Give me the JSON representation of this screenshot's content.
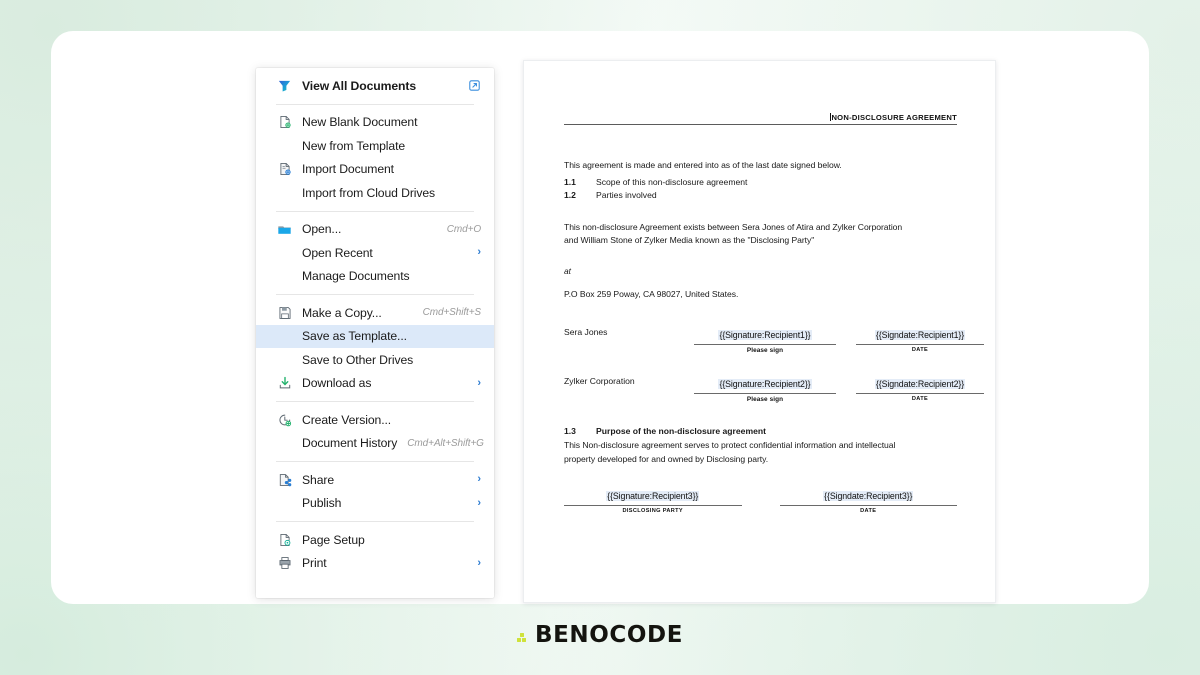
{
  "app": {
    "background_accent": "#e7f4ec",
    "canvas_color": "#ffffff"
  },
  "menu": {
    "highlight_color": "#dce9f9",
    "groups": [
      {
        "items": [
          {
            "label": "View All Documents",
            "icon": "writer-logo-icon",
            "bold": true,
            "trailing_icon": "external-link-icon",
            "shortcut": "",
            "submenu": false
          }
        ]
      },
      {
        "items": [
          {
            "label": "New Blank Document",
            "icon": "new-document-icon",
            "shortcut": "",
            "submenu": false
          },
          {
            "label": "New from Template",
            "icon": "",
            "shortcut": "",
            "submenu": false
          },
          {
            "label": "Import Document",
            "icon": "import-document-icon",
            "shortcut": "",
            "submenu": false
          },
          {
            "label": "Import from Cloud Drives",
            "icon": "",
            "shortcut": "",
            "submenu": false
          }
        ]
      },
      {
        "items": [
          {
            "label": "Open...",
            "icon": "folder-open-icon",
            "shortcut": "Cmd+O",
            "submenu": false
          },
          {
            "label": "Open Recent",
            "icon": "",
            "shortcut": "",
            "submenu": true
          },
          {
            "label": "Manage Documents",
            "icon": "",
            "shortcut": "",
            "submenu": false
          }
        ]
      },
      {
        "items": [
          {
            "label": "Make a Copy...",
            "icon": "save-floppy-icon",
            "shortcut": "Cmd+Shift+S",
            "submenu": false
          },
          {
            "label": "Save as Template...",
            "icon": "",
            "shortcut": "",
            "submenu": false,
            "selected": true
          },
          {
            "label": "Save to Other Drives",
            "icon": "",
            "shortcut": "",
            "submenu": false
          },
          {
            "label": "Download as",
            "icon": "download-icon",
            "shortcut": "",
            "submenu": true
          }
        ]
      },
      {
        "items": [
          {
            "label": "Create Version...",
            "icon": "clock-add-icon",
            "shortcut": "",
            "submenu": false
          },
          {
            "label": "Document History",
            "icon": "",
            "shortcut": "Cmd+Alt+Shift+G",
            "submenu": false
          }
        ]
      },
      {
        "items": [
          {
            "label": "Share",
            "icon": "share-document-icon",
            "shortcut": "",
            "submenu": true
          },
          {
            "label": "Publish",
            "icon": "",
            "shortcut": "",
            "submenu": true
          }
        ]
      },
      {
        "items": [
          {
            "label": "Page Setup",
            "icon": "page-setup-icon",
            "shortcut": "",
            "submenu": false
          },
          {
            "label": "Print",
            "icon": "printer-icon",
            "shortcut": "",
            "submenu": true
          }
        ]
      }
    ]
  },
  "document": {
    "header": "NON-DISCLOSURE AGREEMENT",
    "intro": "This agreement is made and entered into as of the last date signed below.",
    "clauses": [
      {
        "num": "1.1",
        "text": "Scope of this non-disclosure agreement"
      },
      {
        "num": "1.2",
        "text": "Parties involved"
      }
    ],
    "parties_paragraph": "This non-disclosure Agreement exists between Sera Jones of Atira and Zylker Corporation and William Stone of Zylker Media known as the \"Disclosing Party\"",
    "at_label": "at",
    "address": "P.O Box 259 Poway, CA 98027, United States.",
    "signature_rows": [
      {
        "party": "Sera Jones",
        "signature_token": "{{Signature:Recipient1}}",
        "signature_caption": "Please sign",
        "date_token": "{{Signdate:Recipient1}}",
        "date_caption": "DATE"
      },
      {
        "party": "Zylker Corporation",
        "signature_token": "{{Signature:Recipient2}}",
        "signature_caption": "Please sign",
        "date_token": "{{Signdate:Recipient2}}",
        "date_caption": "DATE"
      }
    ],
    "purpose_clause": {
      "num": "1.3",
      "text": "Purpose of the non-disclosure agreement"
    },
    "purpose_body": "This Non-disclosure agreement serves to protect confidential information and intellectual property developed for and owned by Disclosing party.",
    "bottom_signature": {
      "signature_token": "{{Signature:Recipient3}}",
      "signature_caption": "DISCLOSING PARTY",
      "date_token": "{{Signdate:Recipient3}}",
      "date_caption": "DATE"
    }
  },
  "footer": {
    "logo_text": "BENOCODE",
    "logo_dot_color": "#cfe23a"
  }
}
